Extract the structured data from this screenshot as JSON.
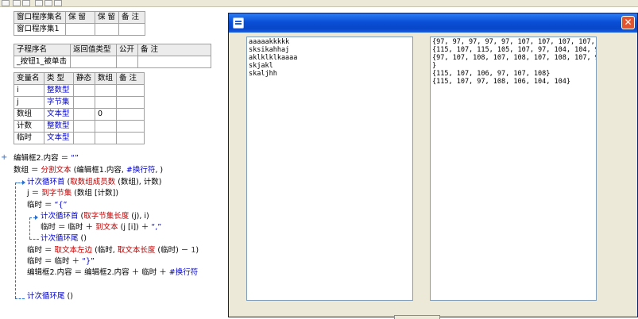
{
  "window_table": {
    "headers": [
      "窗口程序集名",
      "保 留",
      "保 留",
      "备 注"
    ],
    "row": [
      "窗口程序集1",
      "",
      "",
      ""
    ]
  },
  "sub_table": {
    "headers": [
      "子程序名",
      "返回值类型",
      "公开",
      "备 注"
    ],
    "row": [
      "_按钮1_被单击",
      "",
      "",
      ""
    ]
  },
  "var_table": {
    "headers": [
      "变量名",
      "类 型",
      "静态",
      "数组",
      "备 注"
    ],
    "rows": [
      {
        "name": "i",
        "type": "整数型",
        "static": "",
        "array": "",
        "note": ""
      },
      {
        "name": "j",
        "type": "字节集",
        "static": "",
        "array": "",
        "note": ""
      },
      {
        "name": "数组",
        "type": "文本型",
        "static": "",
        "array": "0",
        "note": ""
      },
      {
        "name": "计数",
        "type": "整数型",
        "static": "",
        "array": "",
        "note": ""
      },
      {
        "name": "临时",
        "type": "文本型",
        "static": "",
        "array": "",
        "note": ""
      }
    ]
  },
  "code": {
    "l1": {
      "a": "编辑框2.内容 ＝ ",
      "b": "“”"
    },
    "l2": {
      "a": "数组 ＝ ",
      "b": "分割文本",
      "c": " (编辑框1.内容, ",
      "d": "#换行符",
      "e": ", )"
    },
    "l3": {
      "a": "计次循环首",
      "b": " (",
      "c": "取数组成员数",
      "d": " (数组), 计数)"
    },
    "l4": {
      "a": "j ＝ ",
      "b": "到字节集",
      "c": " (数组 [计数])"
    },
    "l5": {
      "a": "临时 ＝ ",
      "b": "“{”"
    },
    "l6": {
      "a": "计次循环首",
      "b": " (",
      "c": "取字节集长度",
      "d": " (j), i)"
    },
    "l7": {
      "a": "临时 ＝ 临时 ＋ ",
      "b": "到文本",
      "c": " (j [i]) ＋ ",
      "d": "“,”"
    },
    "l8": {
      "a": "计次循环尾",
      "b": " ()"
    },
    "l9": {
      "a": "临时 ＝ ",
      "b": "取文本左边",
      "c": " (临时, ",
      "d": "取文本长度",
      "e": " (临时) － ",
      "f": "1",
      "g": ")"
    },
    "l10": {
      "a": "临时 ＝ 临时 ＋ ",
      "b": "“}”"
    },
    "l11": {
      "a": "编辑框2.内容 ＝ 编辑框2.内容 ＋ 临时 ＋ ",
      "b": "#换行符"
    },
    "l12": {
      "a": "计次循环尾",
      "b": " ()"
    }
  },
  "dialog": {
    "close_glyph": "✕",
    "left_edit_lines": [
      "aaaaakkkkk",
      "sksikahhaj",
      "aklklklkaaaa",
      "skjakl",
      "skaljhh"
    ],
    "right_edit_lines": [
      "{97, 97, 97, 97, 97, 107, 107, 107, 107, 107}",
      "{115, 107, 115, 105, 107, 97, 104, 104, 97, 106}",
      "{97, 107, 108, 107, 108, 107, 108, 107, 97, 97, 97, 97",
      "}",
      "{115, 107, 106, 97, 107, 108}",
      "{115, 107, 97, 108, 106, 104, 104}"
    ]
  },
  "colors": {
    "keyword": "#0000d0",
    "function": "#c00000",
    "titlebar": "#0a4fd6"
  }
}
